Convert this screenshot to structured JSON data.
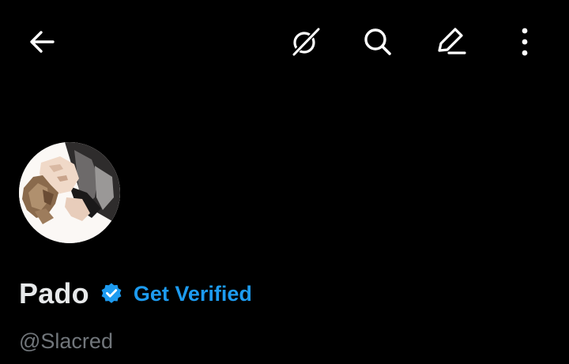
{
  "header": {
    "icons": {
      "back": "arrow-left-icon",
      "grok": "grok-icon",
      "search": "search-icon",
      "edit": "edit-icon",
      "more": "more-vertical-icon"
    }
  },
  "profile": {
    "name": "Pado",
    "verify_label": "Get Verified",
    "handle": "@Slacred",
    "avatar_icon": "avatar-image",
    "badge_icon": "verified-badge-icon"
  },
  "colors": {
    "background": "#000000",
    "text_primary": "#e7e9ea",
    "text_secondary": "#71767b",
    "accent": "#1d9bf0"
  }
}
